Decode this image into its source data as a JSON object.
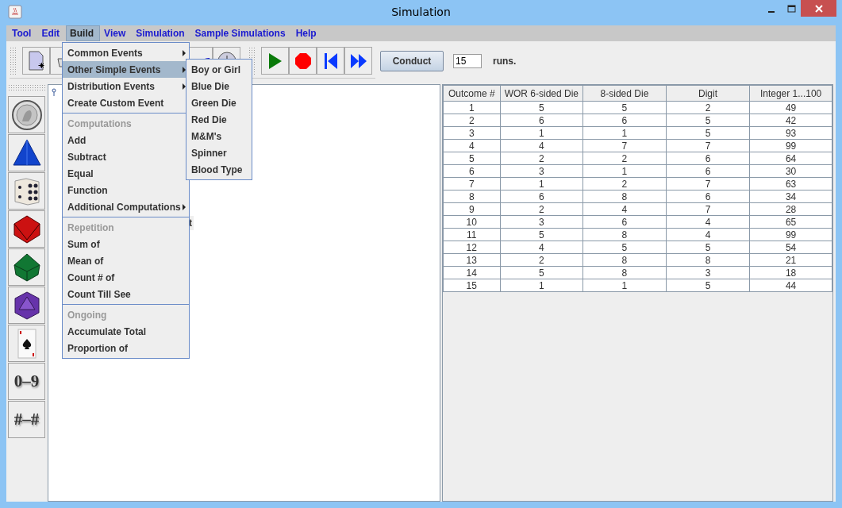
{
  "window": {
    "title": "Simulation"
  },
  "menu_bar": [
    {
      "label": "Tool",
      "selected": false
    },
    {
      "label": "Edit",
      "selected": false
    },
    {
      "label": "Build",
      "selected": true
    },
    {
      "label": "View",
      "selected": false
    },
    {
      "label": "Simulation",
      "selected": false
    },
    {
      "label": "Sample Simulations",
      "selected": false
    },
    {
      "label": "Help",
      "selected": false
    }
  ],
  "build_menu": {
    "groups": [
      {
        "items": [
          {
            "label": "Common Events",
            "has_submenu": true,
            "selected": false
          },
          {
            "label": "Other Simple Events",
            "has_submenu": true,
            "selected": true
          },
          {
            "label": "Distribution Events",
            "has_submenu": true,
            "selected": false
          },
          {
            "label": "Create Custom Event",
            "has_submenu": false,
            "selected": false
          }
        ]
      },
      {
        "header": "Computations",
        "items": [
          {
            "label": "Add",
            "has_submenu": false,
            "selected": false
          },
          {
            "label": "Subtract",
            "has_submenu": false,
            "selected": false
          },
          {
            "label": "Equal",
            "has_submenu": false,
            "selected": false
          },
          {
            "label": "Function",
            "has_submenu": false,
            "selected": false
          },
          {
            "label": "Additional Computations",
            "has_submenu": true,
            "selected": false
          }
        ]
      },
      {
        "header": "Repetition",
        "items": [
          {
            "label": "Sum of",
            "has_submenu": false,
            "selected": false
          },
          {
            "label": "Mean of",
            "has_submenu": false,
            "selected": false
          },
          {
            "label": "Count # of",
            "has_submenu": false,
            "selected": false
          },
          {
            "label": "Count Till See",
            "has_submenu": false,
            "selected": false
          }
        ]
      },
      {
        "header": "Ongoing",
        "items": [
          {
            "label": "Accumulate Total",
            "has_submenu": false,
            "selected": false
          },
          {
            "label": "Proportion of",
            "has_submenu": false,
            "selected": false
          }
        ]
      }
    ]
  },
  "submenu": {
    "items": [
      "Boy or Girl",
      "Blue Die",
      "Green Die",
      "Red Die",
      "M&M's",
      "Spinner",
      "Blood Type"
    ]
  },
  "toolbar": {
    "left_tools": [
      {
        "kind": "new"
      },
      {
        "kind": "basket"
      },
      {
        "kind": "undo"
      },
      {
        "kind": "clock"
      }
    ],
    "run_tools": [
      {
        "kind": "play"
      },
      {
        "kind": "stop"
      },
      {
        "kind": "first"
      },
      {
        "kind": "fast_forward"
      }
    ],
    "conduct_button": "Conduct",
    "runs_value": "15",
    "runs_label": "runs."
  },
  "palette": [
    {
      "kind": "coin"
    },
    {
      "kind": "d4"
    },
    {
      "kind": "d6"
    },
    {
      "kind": "d8"
    },
    {
      "kind": "d10"
    },
    {
      "kind": "d20"
    },
    {
      "kind": "card"
    },
    {
      "kind": "text",
      "label": "0–9"
    },
    {
      "kind": "text",
      "label": "#–#"
    }
  ],
  "canvas": {
    "fragment": "t"
  },
  "table": {
    "columns": [
      "Outcome #",
      "WOR 6-sided Die",
      "8-sided Die",
      "Digit",
      "Integer 1...100"
    ],
    "rows": [
      [
        "1",
        "5",
        "5",
        "2",
        "49"
      ],
      [
        "2",
        "6",
        "6",
        "5",
        "42"
      ],
      [
        "3",
        "1",
        "1",
        "5",
        "93"
      ],
      [
        "4",
        "4",
        "7",
        "7",
        "99"
      ],
      [
        "5",
        "2",
        "2",
        "6",
        "64"
      ],
      [
        "6",
        "3",
        "1",
        "6",
        "30"
      ],
      [
        "7",
        "1",
        "2",
        "7",
        "63"
      ],
      [
        "8",
        "6",
        "8",
        "6",
        "34"
      ],
      [
        "9",
        "2",
        "4",
        "7",
        "28"
      ],
      [
        "10",
        "3",
        "6",
        "4",
        "65"
      ],
      [
        "11",
        "5",
        "8",
        "4",
        "99"
      ],
      [
        "12",
        "4",
        "5",
        "5",
        "54"
      ],
      [
        "13",
        "2",
        "8",
        "8",
        "21"
      ],
      [
        "14",
        "5",
        "8",
        "3",
        "18"
      ],
      [
        "15",
        "1",
        "1",
        "5",
        "44"
      ]
    ]
  }
}
